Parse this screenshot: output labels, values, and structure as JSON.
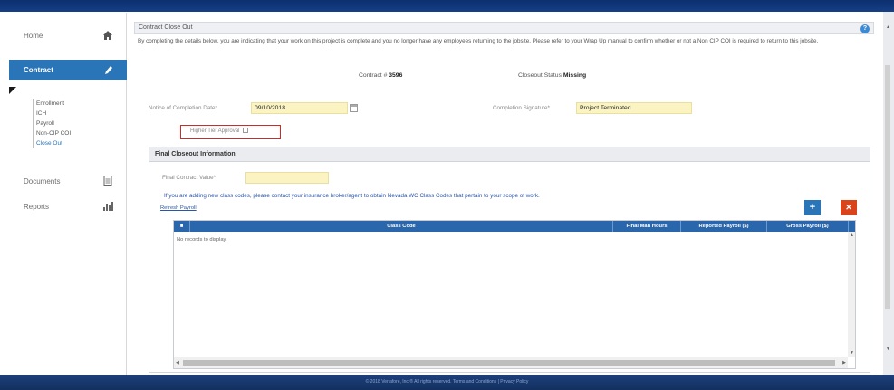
{
  "sidebar": {
    "home_label": "Home",
    "contract_label": "Contract",
    "subitems": [
      "Enrollment",
      "ICH",
      "Payroll",
      "Non-CIP COI",
      "Close Out"
    ],
    "documents_label": "Documents",
    "reports_label": "Reports"
  },
  "page": {
    "header_title": "Contract Close Out",
    "intro": "By completing the details below, you are indicating that your work on this project is complete and you no longer have any employees returning to the jobsite. Please refer to your Wrap Up manual to confirm whether or not a Non CIP COI is required to return to this jobsite.",
    "contract_label": "Contract #",
    "contract_number": "3596",
    "status_label": "Closeout Status",
    "status_value": "Missing",
    "notice_label": "Notice of Completion Date*",
    "notice_value": "09/10/2018",
    "signature_label": "Completion Signature*",
    "signature_value": "Project Terminated",
    "higher_tier_label": "Higher Tier Approval"
  },
  "final_closeout": {
    "title": "Final Closeout Information",
    "contract_value_label": "Final Contract Value*",
    "contract_value": "",
    "info": "If you are adding new class codes, please contact your insurance broker/agent to obtain Nevada WC Class Codes that pertain to your scope of work.",
    "refresh_label": "Refresh Payroll",
    "add_label": "+",
    "delete_label": "✕",
    "columns": [
      "Class Code",
      "Final Man Hours",
      "Reported Payroll ($)",
      "Gross Payroll ($)"
    ],
    "empty_text": "No records to display."
  },
  "footer": {
    "text": "© 2018 Vertafore, Inc ® All rights reserved. Terms and Conditions | Privacy Policy"
  },
  "colors": {
    "accent": "#2a74b8",
    "danger": "#d9441c",
    "highlight_field": "#fbf4c2",
    "topbar": "#0c2f6e"
  }
}
